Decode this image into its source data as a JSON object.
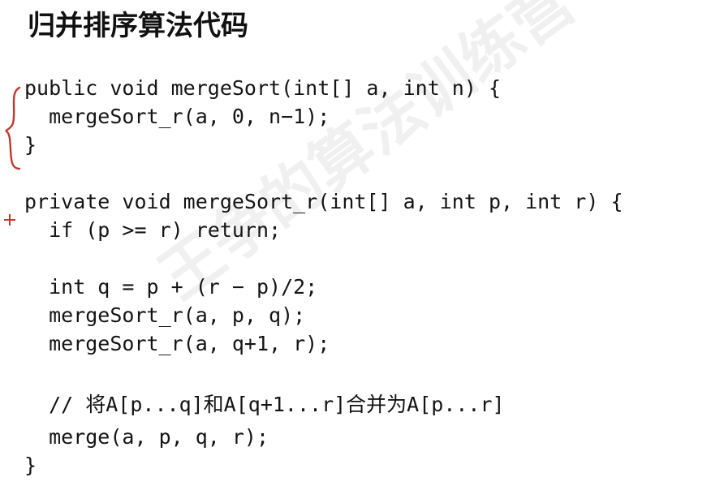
{
  "title": "归并排序算法代码",
  "code_lines": [
    "public void mergeSort(int[] a, int n) {",
    "  mergeSort_r(a, 0, n−1);",
    "}",
    "",
    "private void mergeSort_r(int[] a, int p, int r) {",
    "  if (p >= r) return;",
    "",
    "  int q = p + (r − p)/2;",
    "  mergeSort_r(a, p, q);",
    "  mergeSort_r(a, q+1, r);",
    "",
    "  // 将A[p...q]和A[q+1...r]合并为A[p...r]",
    "  merge(a, p, q, r);",
    "}"
  ],
  "watermark": "王争的算法训练营",
  "annotation_color": "#c0392b"
}
